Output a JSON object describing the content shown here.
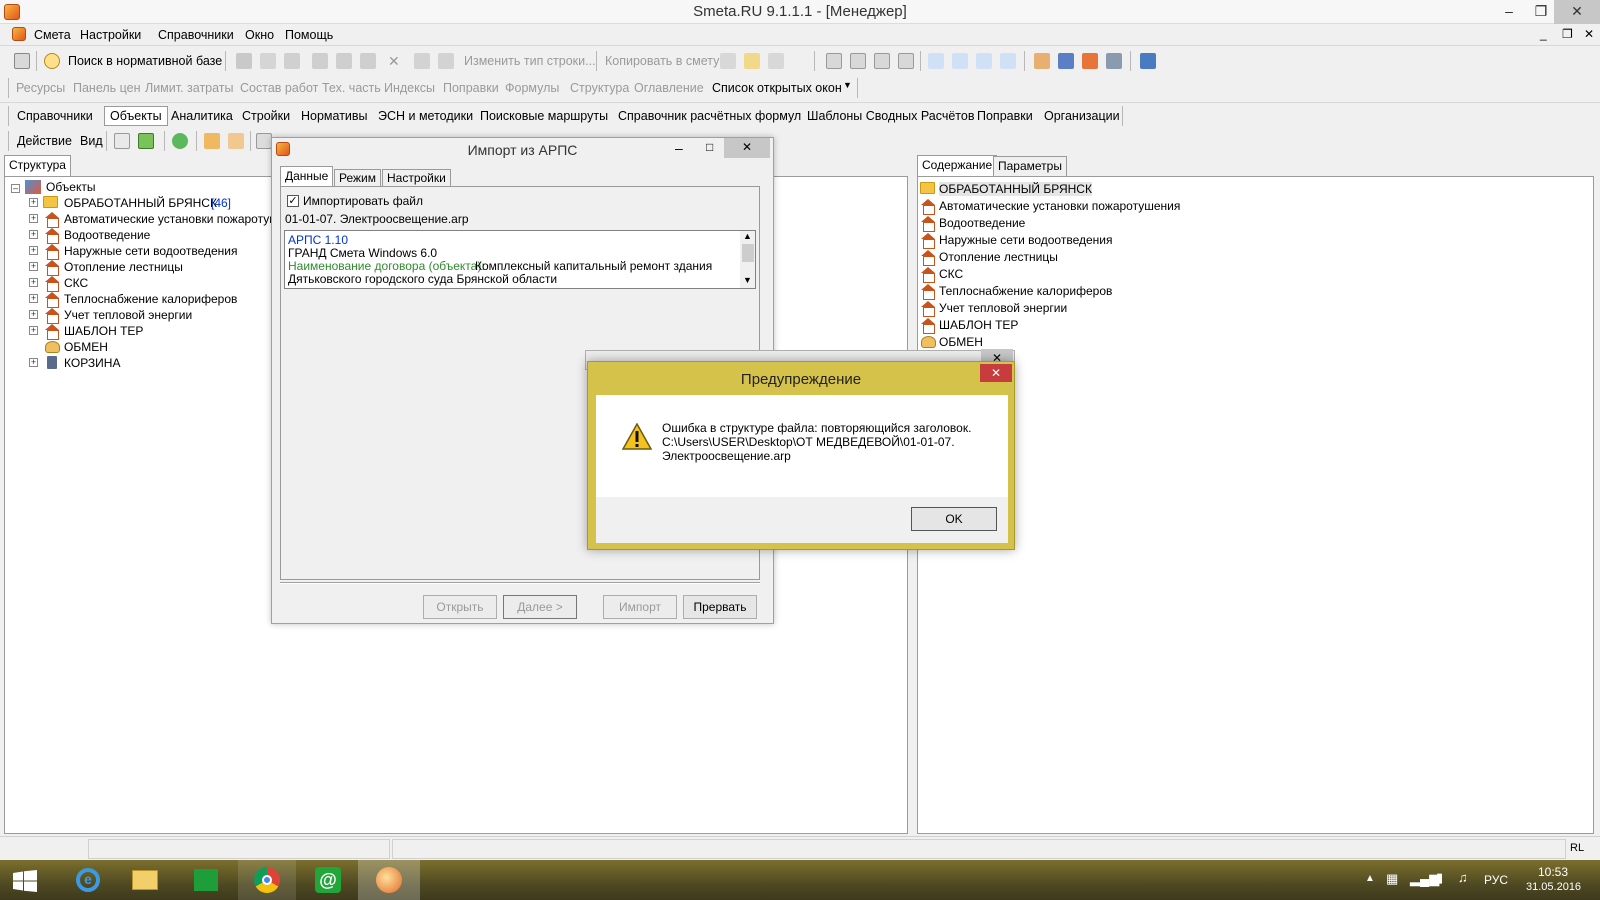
{
  "window": {
    "title": "Smeta.RU  9.1.1.1   - [Менеджер]"
  },
  "menu": [
    "Смета",
    "Настройки",
    "Справочники",
    "Окно",
    "Помощь"
  ],
  "toolbar1": {
    "search_label": "Поиск в нормативной базе",
    "change_row_type": "Изменить тип строки...",
    "copy_to_estimate": "Копировать в смету"
  },
  "toolbar2": {
    "items": [
      "Ресурсы",
      "Панель цен",
      "Лимит. затраты",
      "Состав работ",
      "Тех. часть",
      "Индексы",
      "Поправки",
      "Формулы",
      "Структура",
      "Оглавление"
    ],
    "open_windows": "Список открытых окон"
  },
  "toolbar3": {
    "items": [
      "Справочники",
      "Объекты",
      "Аналитика",
      "Стройки",
      "Нормативы",
      "ЭСН и методики",
      "Поисковые маршруты",
      "Справочник расчётных формул",
      "Шаблоны Сводных Расчётов",
      "Поправки",
      "Организации"
    ]
  },
  "toolbar4": {
    "action": "Действие",
    "view": "Вид"
  },
  "left_panel": {
    "tab": "Структура",
    "root": "Объекты",
    "items": [
      {
        "label": "ОБРАБОТАННЫЙ БРЯНСК",
        "count": "[46]",
        "icon": "folder-icon"
      },
      {
        "label": "Автоматические установки пожаротуш",
        "icon": "house-icon"
      },
      {
        "label": "Водоотведение",
        "icon": "house-icon"
      },
      {
        "label": "Наружные сети водоотведения",
        "icon": "house-icon"
      },
      {
        "label": "Отопление лестницы",
        "icon": "house-icon"
      },
      {
        "label": "СКС",
        "icon": "house-icon"
      },
      {
        "label": "Теплоснабжение калориферов",
        "icon": "house-icon"
      },
      {
        "label": "Учет тепловой энергии",
        "icon": "house-icon"
      },
      {
        "label": "ШАБЛОН ТЕР",
        "icon": "house-icon"
      },
      {
        "label": "ОБМЕН",
        "icon": "exchange-icon"
      },
      {
        "label": "КОРЗИНА",
        "icon": "trash-icon"
      }
    ]
  },
  "right_panel": {
    "tabs": [
      "Содержание",
      "Параметры"
    ],
    "items": [
      {
        "label": "ОБРАБОТАННЫЙ БРЯНСК",
        "icon": "folder-icon"
      },
      {
        "label": "Автоматические установки пожаротушения",
        "icon": "house-icon"
      },
      {
        "label": "Водоотведение",
        "icon": "house-icon"
      },
      {
        "label": "Наружные сети водоотведения",
        "icon": "house-icon"
      },
      {
        "label": "Отопление лестницы",
        "icon": "house-icon"
      },
      {
        "label": "СКС",
        "icon": "house-icon"
      },
      {
        "label": "Теплоснабжение калориферов",
        "icon": "house-icon"
      },
      {
        "label": "Учет тепловой энергии",
        "icon": "house-icon"
      },
      {
        "label": "ШАБЛОН ТЕР",
        "icon": "house-icon"
      },
      {
        "label": "ОБМЕН",
        "icon": "exchange-icon"
      }
    ]
  },
  "import_dialog": {
    "title": "Импорт из АРПС",
    "tabs": [
      "Данные",
      "Режим",
      "Настройки"
    ],
    "checkbox_label": "Импортировать файл",
    "checked": true,
    "filename": "01-01-07. Электроосвещение.arp",
    "log": {
      "line1": "АРПС 1.10",
      "line2": "ГРАНД Смета Windows 6.0",
      "line3_label": "Наименование договора (объекта):",
      "line3_value": "Комплексный капитальный ремонт здания",
      "line4": "Дятьковского городского суда Брянской области"
    },
    "buttons": {
      "open": "Открыть",
      "next": "Далее >",
      "import": "Импорт",
      "abort": "Прервать"
    }
  },
  "warning_dialog": {
    "title": "Предупреждение",
    "message_line1": "Ошибка в структуре файла: повторяющийся заголовок.",
    "message_line2": "C:\\Users\\USER\\Desktop\\ОТ МЕДВЕДЕВОЙ\\01-01-07.",
    "message_line3": "Электроосвещение.arp",
    "ok": "OK"
  },
  "statusbar": {
    "lang": "RL"
  },
  "taskbar": {
    "lang": "РУС",
    "time": "10:53",
    "date": "31.05.2016"
  },
  "colors": {
    "warning_frame": "#d4c24a",
    "link_blue": "#0033cc",
    "green_label": "#2e8b2e"
  }
}
